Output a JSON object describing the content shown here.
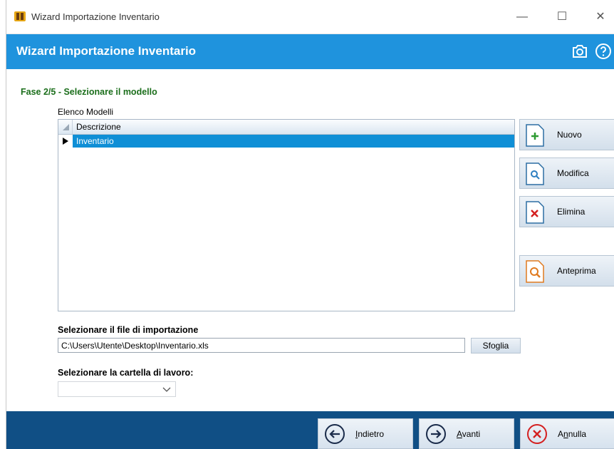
{
  "window": {
    "title": "Wizard Importazione Inventario"
  },
  "header": {
    "title": "Wizard Importazione Inventario",
    "camera_icon": "camera-icon",
    "help_icon": "help-icon"
  },
  "step": "Fase 2/5 - Selezionare il modello",
  "models": {
    "label": "Elenco Modelli",
    "column": "Descrizione",
    "rows": [
      "Inventario"
    ]
  },
  "side_buttons": {
    "new": "Nuovo",
    "edit": "Modifica",
    "delete": "Elimina",
    "preview": "Anteprima"
  },
  "file": {
    "label": "Selezionare il file di importazione",
    "value": "C:\\Users\\Utente\\Desktop\\Inventario.xls",
    "browse": "Sfoglia"
  },
  "sheet": {
    "label": "Selezionare la cartella di lavoro:",
    "value": ""
  },
  "nav": {
    "back": "Indietro",
    "next": "Avanti",
    "cancel": "Annulla"
  },
  "colors": {
    "header": "#1f93dd",
    "footer": "#104f85",
    "step": "#1b6e1b",
    "selection": "#0f8fd6"
  }
}
